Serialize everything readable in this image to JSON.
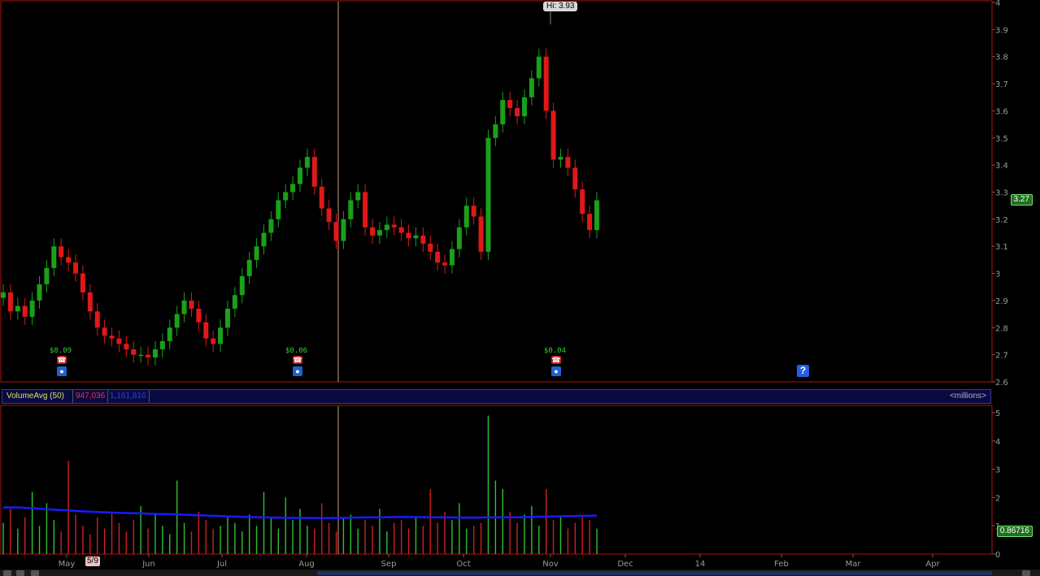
{
  "chart_data": [
    {
      "type": "candlestick",
      "title": "",
      "ylim": [
        2.6,
        4.0
      ],
      "y_ticks": [
        "2.6",
        "2.7",
        "2.8",
        "2.9",
        "3",
        "3.1",
        "3.2",
        "3.3",
        "3.4",
        "3.5",
        "3.6",
        "3.7",
        "3.8",
        "3.9",
        "4"
      ],
      "x_ticks": [
        "May",
        "Jun",
        "Jul",
        "Aug",
        "Sep",
        "Oct",
        "Nov",
        "Dec",
        "14",
        "Feb",
        "Mar",
        "Apr"
      ],
      "high_label": "Hi: 3.93",
      "last_price": "3.27",
      "grid": false,
      "earnings": [
        "$0.09",
        "$0.06",
        "$0.04"
      ],
      "closes": [
        2.93,
        2.86,
        2.88,
        2.84,
        2.9,
        2.96,
        3.02,
        3.1,
        3.06,
        3.04,
        3.0,
        2.93,
        2.86,
        2.8,
        2.77,
        2.76,
        2.74,
        2.72,
        2.7,
        2.7,
        2.69,
        2.72,
        2.75,
        2.8,
        2.85,
        2.9,
        2.87,
        2.82,
        2.76,
        2.74,
        2.8,
        2.87,
        2.92,
        2.99,
        3.05,
        3.1,
        3.15,
        3.2,
        3.27,
        3.3,
        3.33,
        3.39,
        3.43,
        3.32,
        3.24,
        3.19,
        3.12,
        3.2,
        3.27,
        3.3,
        3.17,
        3.14,
        3.16,
        3.18,
        3.17,
        3.15,
        3.13,
        3.14,
        3.11,
        3.08,
        3.04,
        3.03,
        3.09,
        3.17,
        3.25,
        3.21,
        3.08,
        3.5,
        3.55,
        3.64,
        3.61,
        3.58,
        3.65,
        3.72,
        3.8,
        3.6,
        3.42,
        3.43,
        3.39,
        3.31,
        3.22,
        3.16,
        3.27
      ],
      "volume": {
        "series": [
          {
            "name": "VolumeAvg (50)"
          }
        ],
        "values_millions": [
          1.1,
          1.6,
          0.9,
          1.3,
          2.2,
          1.0,
          1.8,
          1.2,
          0.8,
          3.3,
          1.4,
          1.0,
          0.7,
          1.3,
          0.9,
          1.5,
          1.1,
          0.8,
          1.2,
          1.7,
          0.9,
          1.4,
          1.0,
          0.7,
          2.6,
          1.1,
          0.8,
          1.5,
          1.2,
          0.9,
          1.0,
          1.3,
          1.1,
          0.8,
          1.4,
          1.0,
          2.2,
          1.3,
          0.9,
          2.0,
          1.2,
          1.6,
          1.0,
          0.9,
          1.8,
          1.1,
          0.8,
          1.3,
          1.4,
          0.9,
          1.2,
          1.0,
          1.6,
          0.8,
          1.1,
          1.2,
          0.9,
          1.3,
          1.0,
          2.3,
          1.1,
          1.5,
          1.2,
          1.8,
          0.9,
          1.0,
          1.1,
          4.9,
          2.6,
          2.3,
          1.5,
          1.1,
          1.4,
          1.7,
          1.0,
          2.3,
          1.2,
          1.3,
          0.9,
          1.1,
          1.3,
          1.2,
          0.9
        ],
        "avg_millions": [
          1.65,
          1.65,
          1.62,
          1.58,
          1.55,
          1.52,
          1.49,
          1.47,
          1.45,
          1.44,
          1.42,
          1.41,
          1.39,
          1.37,
          1.35,
          1.33,
          1.31,
          1.3,
          1.29,
          1.28,
          1.28,
          1.27,
          1.28,
          1.29,
          1.3,
          1.3,
          1.31,
          1.31,
          1.3,
          1.3,
          1.29,
          1.29,
          1.3,
          1.3,
          1.3,
          1.32,
          1.33,
          1.34,
          1.35,
          1.36
        ],
        "ylim": [
          0,
          5
        ],
        "y_ticks": [
          "0",
          "1",
          "2",
          "3",
          "4",
          "5"
        ],
        "units": "<millions>",
        "value_1": "947,036",
        "value_2": "1,161,816",
        "current": "0.86716"
      }
    }
  ],
  "date_marker": "5/9",
  "colors": {
    "up": "#1aa01a",
    "down": "#e01818",
    "avg": "#1a1aff",
    "border": "#b01010",
    "cursor": "#c8a078"
  }
}
